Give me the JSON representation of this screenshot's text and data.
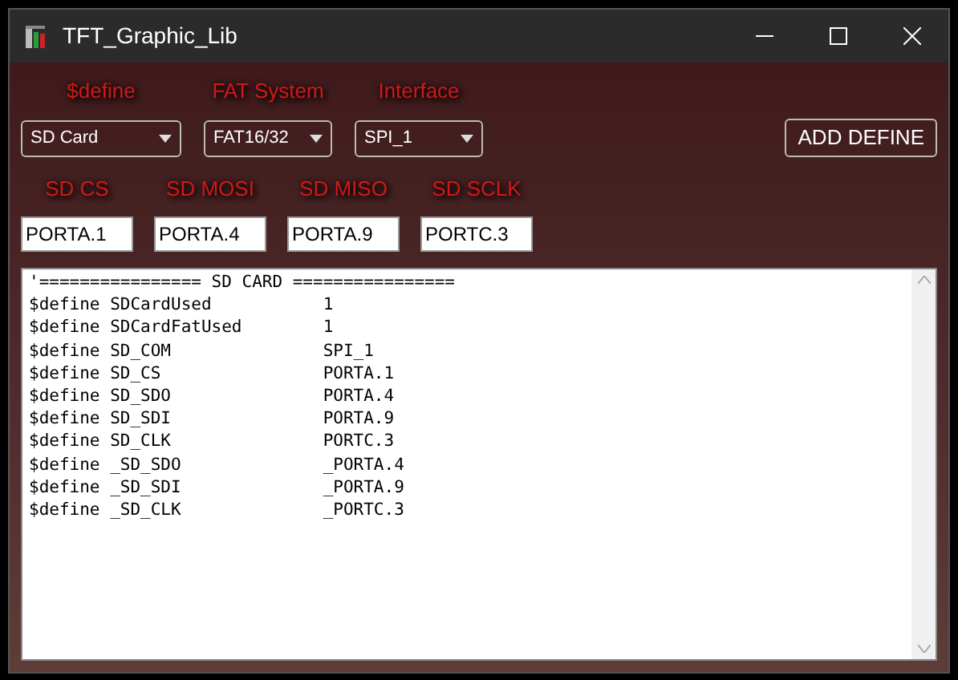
{
  "window": {
    "title": "TFT_Graphic_Lib"
  },
  "selectors": [
    {
      "label": "$define",
      "value": "SD Card"
    },
    {
      "label": "FAT System",
      "value": "FAT16/32"
    },
    {
      "label": "Interface",
      "value": "SPI_1"
    }
  ],
  "add_button": "ADD DEFINE",
  "pins": [
    {
      "label": "SD CS",
      "value": "PORTA.1"
    },
    {
      "label": "SD MOSI",
      "value": "PORTA.4"
    },
    {
      "label": "SD MISO",
      "value": "PORTA.9"
    },
    {
      "label": "SD SCLK",
      "value": "PORTC.3"
    }
  ],
  "code_lines": [
    "'================ SD CARD ================",
    "$define SDCardUsed           1",
    "$define SDCardFatUsed        1",
    "$define SD_COM               SPI_1",
    "$define SD_CS                PORTA.1",
    "$define SD_SDO               PORTA.4",
    "$define SD_SDI               PORTA.9",
    "$define SD_CLK               PORTC.3",
    "$define _SD_SDO              _PORTA.4",
    "$define _SD_SDI              _PORTA.9",
    "$define _SD_CLK              _PORTC.3"
  ]
}
